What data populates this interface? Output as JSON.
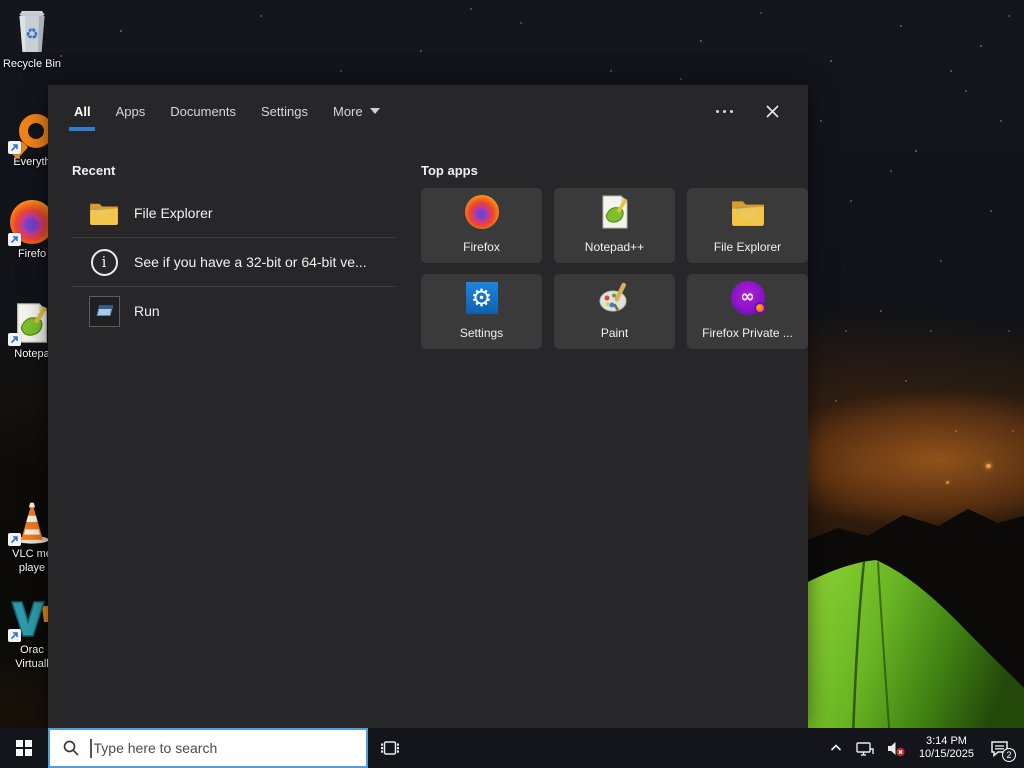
{
  "desktop": {
    "icons": [
      {
        "id": "recycle-bin",
        "label_lines": [
          "Recycle Bin"
        ]
      },
      {
        "id": "everything",
        "label_lines": [
          "Everyth"
        ]
      },
      {
        "id": "firefox",
        "label_lines": [
          "Firefo"
        ]
      },
      {
        "id": "notepad-plus-plus",
        "label_lines": [
          "Notepa"
        ]
      },
      {
        "id": "vlc-media-player",
        "label_lines": [
          "VLC me",
          "playe"
        ]
      },
      {
        "id": "oracle-virtualbox",
        "label_lines": [
          "Orac",
          "Virtuall"
        ]
      }
    ]
  },
  "search_panel": {
    "tabs": [
      {
        "label": "All",
        "selected": true
      },
      {
        "label": "Apps",
        "selected": false
      },
      {
        "label": "Documents",
        "selected": false
      },
      {
        "label": "Settings",
        "selected": false
      },
      {
        "label": "More",
        "selected": false,
        "has_dropdown": true
      }
    ],
    "header_icons": [
      "ellipsis-icon",
      "close-icon"
    ],
    "recent": {
      "header": "Recent",
      "items": [
        {
          "label": "File Explorer",
          "icon": "folder-icon"
        },
        {
          "label": "See if you have a 32-bit or 64-bit ve...",
          "icon": "info-icon"
        },
        {
          "label": "Run",
          "icon": "run-window-icon"
        }
      ]
    },
    "top_apps": {
      "header": "Top apps",
      "tiles": [
        {
          "label": "Firefox",
          "icon": "firefox-icon"
        },
        {
          "label": "Notepad++",
          "icon": "notepad-plus-plus-icon"
        },
        {
          "label": "File Explorer",
          "icon": "folder-icon"
        },
        {
          "label": "Settings",
          "icon": "settings-gear-icon"
        },
        {
          "label": "Paint",
          "icon": "paint-palette-icon"
        },
        {
          "label": "Firefox Private ...",
          "icon": "firefox-private-icon"
        }
      ]
    }
  },
  "taskbar": {
    "search": {
      "placeholder": "Type here to search"
    },
    "tray": {
      "time": "3:14 PM",
      "date": "10/15/2025",
      "notification_count": "2",
      "icons": [
        "chevron-up-icon",
        "network-icon",
        "volume-muted-icon",
        "action-center-icon"
      ]
    }
  },
  "colors": {
    "accent_blue": "#2f7fd3",
    "search_border": "#4f9ee0",
    "panel_bg": "#27272a",
    "tile_bg": "#3a3a3b",
    "taskbar_bg": "#14141b",
    "tent_green": "#6cb823"
  }
}
